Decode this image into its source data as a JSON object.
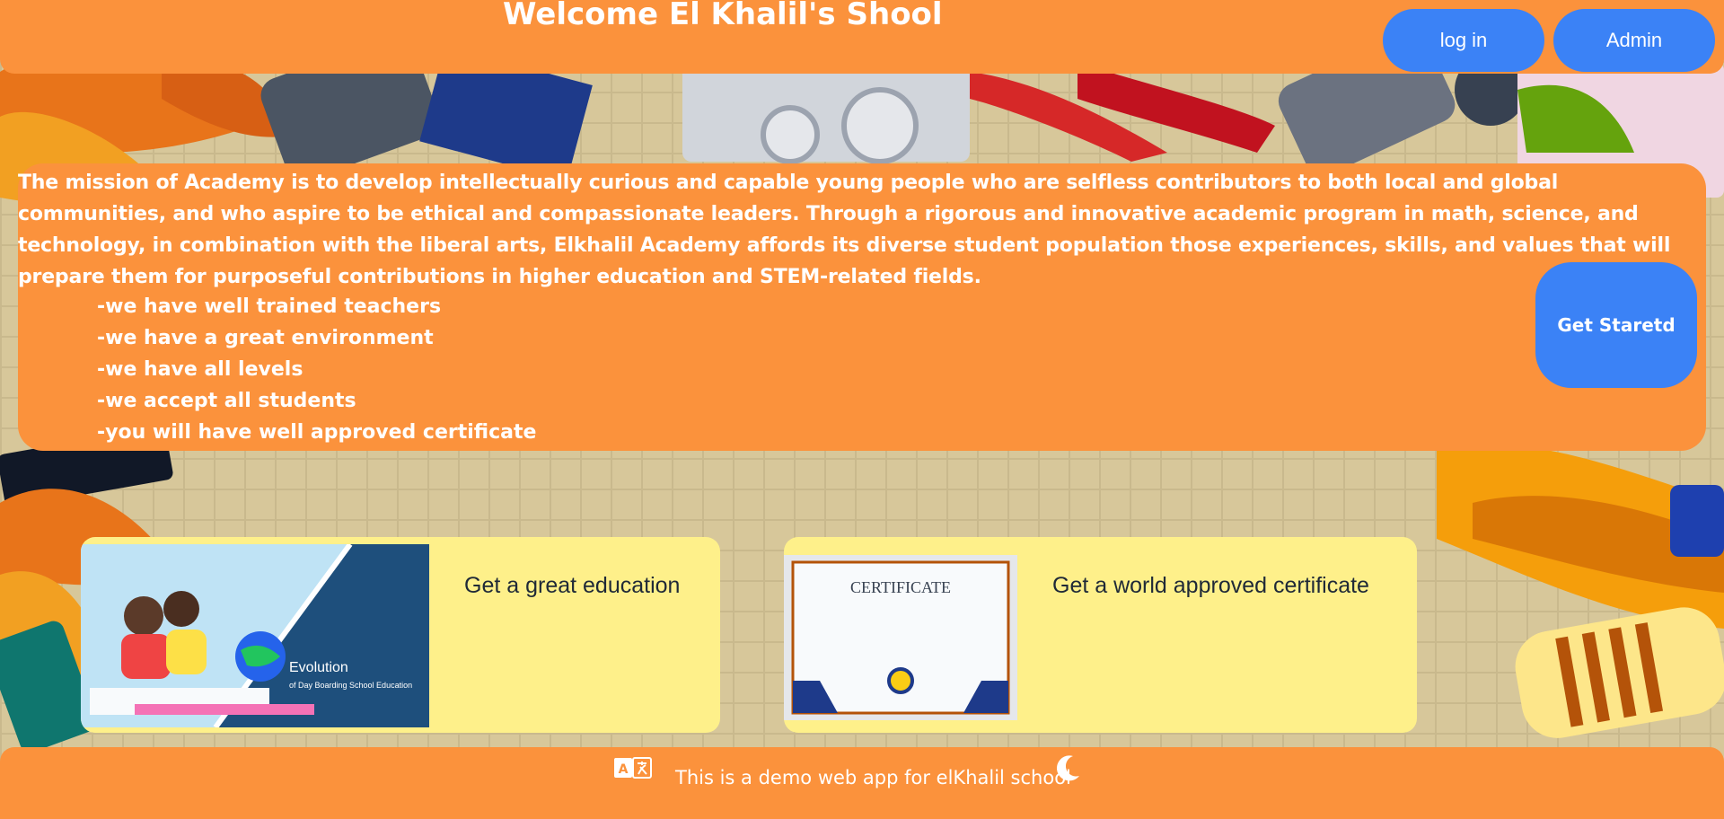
{
  "header": {
    "title": "Welcome El Khalil's Shool",
    "login_label": "log in",
    "admin_label": "Admin"
  },
  "mission": {
    "text": " The mission of Academy is to develop intellectually curious and capable young people who are selfless contributors to both local and global communities, and who aspire to be ethical and compassionate leaders. Through a rigorous and innovative academic program in math, science, and technology, in combination with the liberal arts, Elkhalil Academy affords its diverse student population those experiences, skills, and values that will prepare them for purposeful contributions in higher education and STEM-related fields.",
    "points": [
      "-we have well trained teachers",
      "-we have a great environment",
      "-we have all levels",
      "-we accept all students",
      "-you will have well approved certificate"
    ],
    "cta_label": "Get Staretd"
  },
  "cards": [
    {
      "title": "Get a great education",
      "image_heading": "Evolution",
      "image_caption": "of Day Boarding School Education"
    },
    {
      "title": "Get a world approved certificate",
      "image_heading": "CERTIFICATE"
    }
  ],
  "footer": {
    "text": "This is a demo web app for elKhalil school",
    "translate_icon": "translate-icon",
    "theme_icon": "moon-icon"
  },
  "colors": {
    "orange": "#fb923c",
    "blue": "#3b82f6",
    "card_yellow": "#fef08a"
  }
}
